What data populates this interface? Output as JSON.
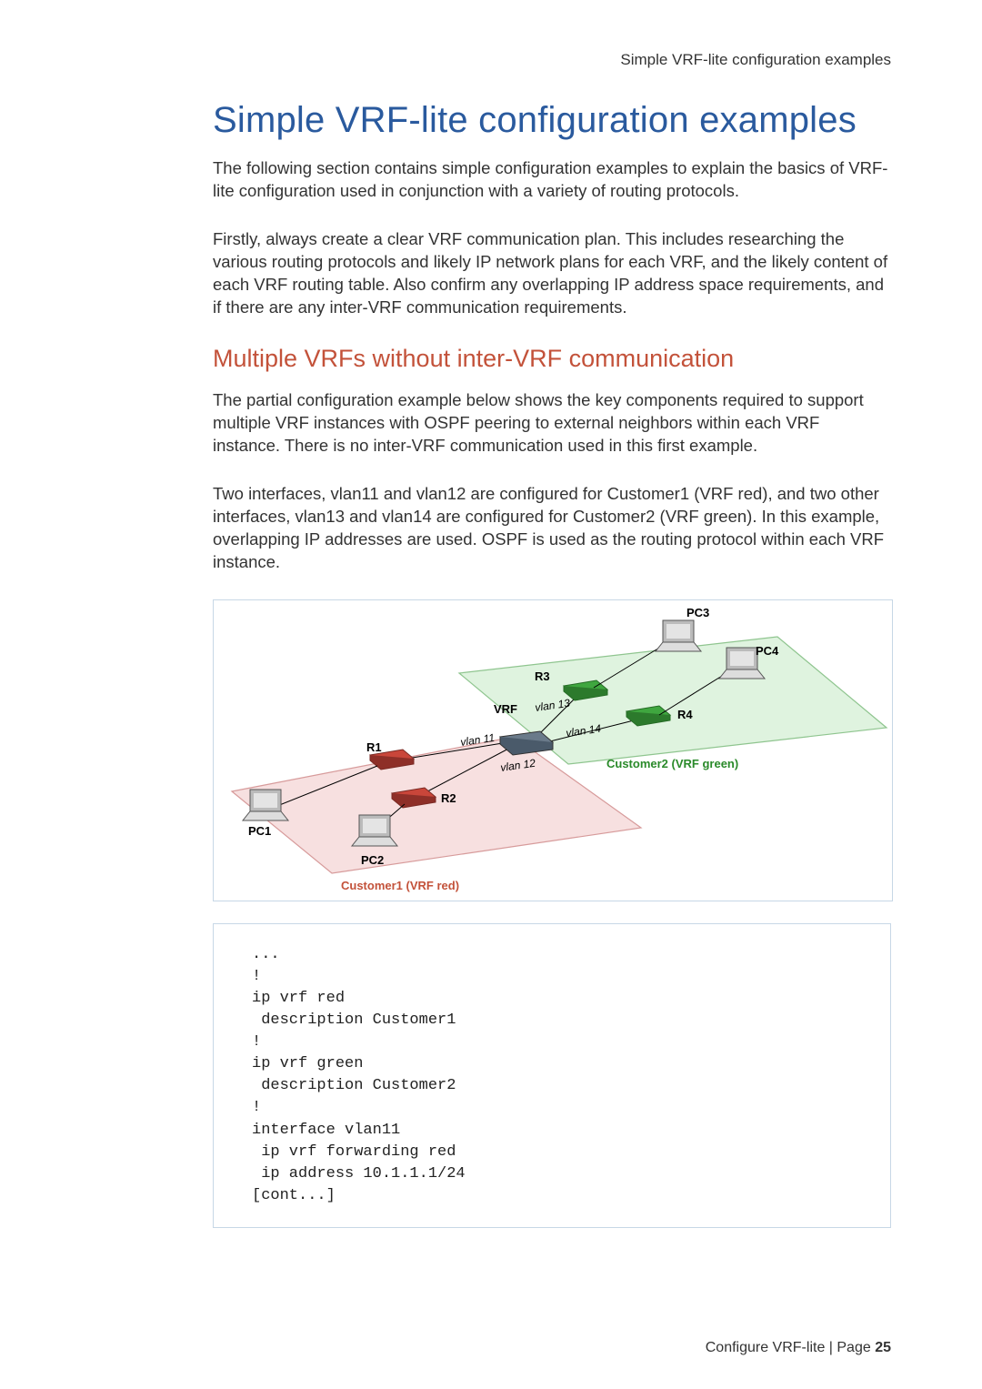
{
  "header": {
    "running": "Simple VRF-lite configuration examples"
  },
  "title": "Simple VRF-lite configuration examples",
  "paragraphs": {
    "p1": "The following section contains simple configuration examples to explain the basics of VRF-lite configuration used in conjunction with a variety of routing protocols.",
    "p2": "Firstly, always create a clear VRF communication plan. This includes researching the various routing protocols and likely IP network plans for each VRF, and the likely content of each VRF routing table. Also confirm any overlapping IP address space requirements, and if there are any inter-VRF communication requirements."
  },
  "subhead": "Multiple VRFs without inter-VRF communication",
  "paragraphs2": {
    "p3": "The partial configuration example below shows the key components required to support multiple VRF instances with OSPF peering to external neighbors within each VRF instance. There is no inter-VRF communication used in this first example.",
    "p4": "Two interfaces, vlan11 and vlan12 are configured for Customer1 (VRF red), and two other interfaces, vlan13 and vlan14 are configured for Customer2 (VRF green). In this example, overlapping IP addresses are used. OSPF is used as the routing protocol within each VRF instance."
  },
  "diagram": {
    "labels": {
      "pc1": "PC1",
      "pc2": "PC2",
      "pc3": "PC3",
      "pc4": "PC4",
      "r1": "R1",
      "r2": "R2",
      "r3": "R3",
      "r4": "R4",
      "vrf": "VRF",
      "vlan11": "vlan 11",
      "vlan12": "vlan 12",
      "vlan13": "vlan 13",
      "vlan14": "vlan 14",
      "cust1": "Customer1 (VRF red)",
      "cust2": "Customer2 (VRF green)"
    }
  },
  "code": "...\n!\nip vrf red\n description Customer1\n!\nip vrf green\n description Customer2\n!\ninterface vlan11\n ip vrf forwarding red\n ip address 10.1.1.1/24\n[cont...]",
  "footer": {
    "text": "Configure VRF-lite | Page ",
    "page": "25"
  }
}
